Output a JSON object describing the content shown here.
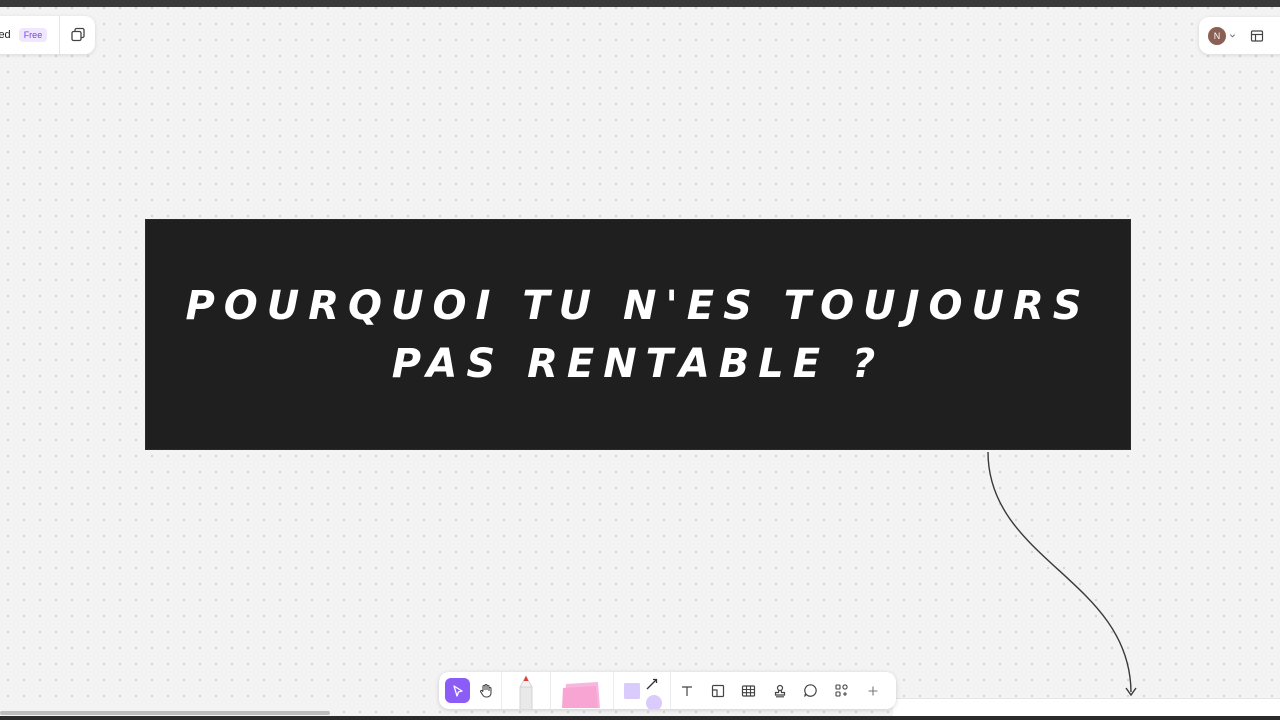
{
  "file": {
    "name": "led",
    "plan_badge": "Free"
  },
  "user": {
    "avatar_initial": "N"
  },
  "banner": {
    "text": "POURQUOI TU N'ES TOUJOURS PAS RENTABLE ?"
  },
  "icons": {
    "pages": "pages-icon",
    "chevron": "chevron-down-icon",
    "layout": "layout-panel-icon",
    "select": "cursor-arrow-icon",
    "hand": "hand-icon",
    "marker": "marker-icon",
    "sticky": "sticky-note-icon",
    "shape": "shape-square-icon",
    "connector": "connector-line-icon",
    "text": "text-icon",
    "frame": "frame-icon",
    "table": "table-icon",
    "stamp": "stamp-icon",
    "comment": "comment-icon",
    "more_tools": "apps-icon",
    "add": "plus-icon"
  },
  "colors": {
    "accent": "#8b5cf6",
    "banner_bg": "#1f1f1f",
    "canvas_bg": "#f3f3f3",
    "sticky": "#f8a5d3",
    "shape_fill": "#d9cbfb"
  }
}
